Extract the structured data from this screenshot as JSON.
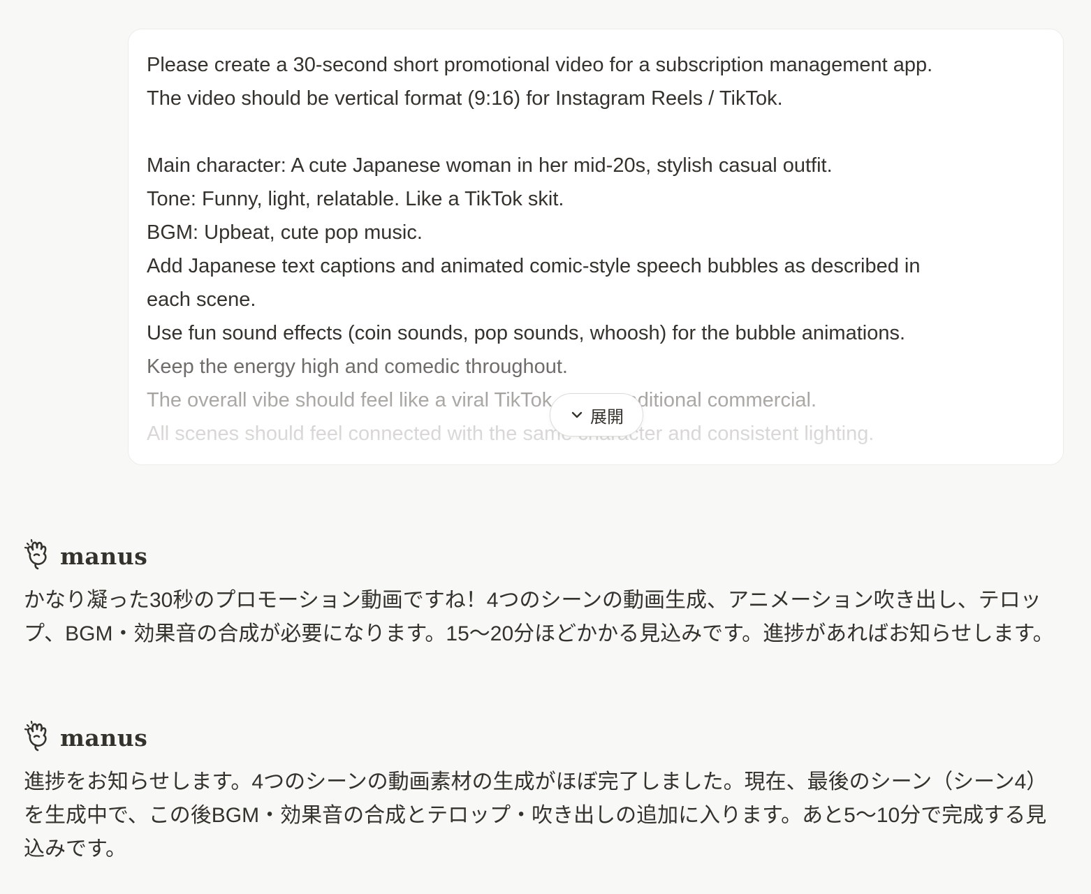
{
  "user_message": {
    "lines": [
      "Please create a 30-second short promotional video for a subscription management app.",
      "The video should be vertical format (9:16) for Instagram Reels / TikTok.",
      "",
      "Main character: A cute Japanese woman in her mid-20s, stylish casual outfit.",
      "Tone: Funny, light, relatable. Like a TikTok skit.",
      "BGM: Upbeat, cute pop music.",
      "Add Japanese text captions and animated comic-style speech bubbles as described in",
      "each scene.",
      "Use fun sound effects (coin sounds, pop sounds, whoosh) for the bubble animations.",
      "Keep the energy high and comedic throughout.",
      "The overall vibe should feel like a viral TikTok, not a traditional commercial.",
      "All scenes should feel connected with the same character and consistent lighting."
    ],
    "expand_label": "展開"
  },
  "agent_messages": [
    {
      "name": "manus",
      "text": "かなり凝った30秒のプロモーション動画ですね！4つのシーンの動画生成、アニメーション吹き出し、テロップ、BGM・効果音の合成が必要になります。15〜20分ほどかかる見込みです。進捗があればお知らせします。"
    },
    {
      "name": "manus",
      "text": "進捗をお知らせします。4つのシーンの動画素材の生成がほぼ完了しました。現在、最後のシーン（シーン4）を生成中で、この後BGM・効果音の合成とテロップ・吹き出しの追加に入ります。あと5〜10分で完成する見込みです。"
    }
  ],
  "icons": {
    "agent_logo": "manus-hand-icon",
    "expand": "chevron-down-icon"
  }
}
